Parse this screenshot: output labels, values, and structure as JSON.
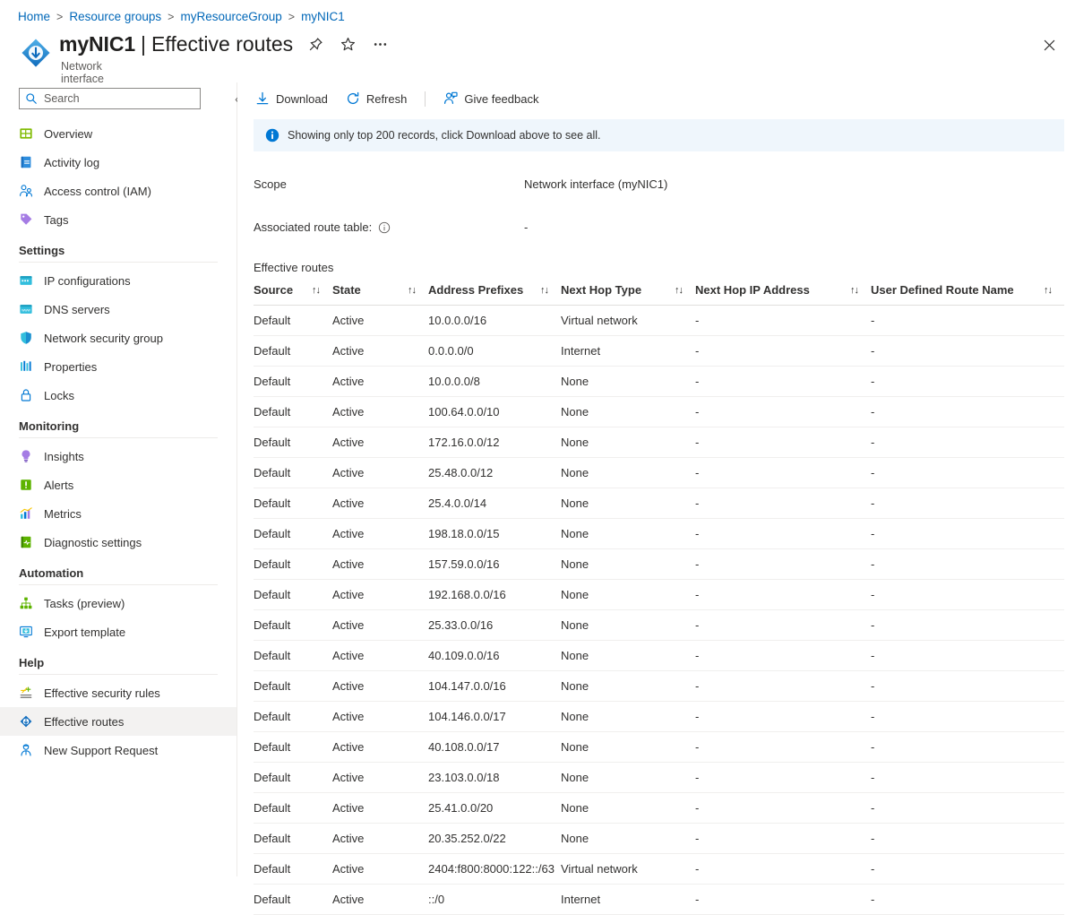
{
  "breadcrumb": [
    {
      "label": "Home"
    },
    {
      "label": "Resource groups"
    },
    {
      "label": "myResourceGroup"
    },
    {
      "label": "myNIC1"
    }
  ],
  "header": {
    "resource_name": "myNIC1",
    "separator": "|",
    "page_name": "Effective routes",
    "resource_type": "Network interface",
    "pin_icon": "pin-icon",
    "favorite_icon": "star-icon",
    "more_icon": "ellipsis-icon",
    "close_icon": "close-icon",
    "nic_icon": "network-interface-icon"
  },
  "sidebar": {
    "search": {
      "placeholder": "Search",
      "value": "",
      "icon": "search-icon"
    },
    "collapse_icon": "chevron-double-left-icon",
    "top_items": [
      {
        "label": "Overview",
        "icon": "overview-icon",
        "selected": false
      },
      {
        "label": "Activity log",
        "icon": "activity-log-icon",
        "selected": false
      },
      {
        "label": "Access control (IAM)",
        "icon": "access-control-icon",
        "selected": false
      },
      {
        "label": "Tags",
        "icon": "tag-icon",
        "selected": false
      }
    ],
    "groups": [
      {
        "title": "Settings",
        "items": [
          {
            "label": "IP configurations",
            "icon": "ip-config-icon",
            "selected": false
          },
          {
            "label": "DNS servers",
            "icon": "dns-server-icon",
            "selected": false
          },
          {
            "label": "Network security group",
            "icon": "shield-icon",
            "selected": false
          },
          {
            "label": "Properties",
            "icon": "properties-icon",
            "selected": false
          },
          {
            "label": "Locks",
            "icon": "lock-icon",
            "selected": false
          }
        ]
      },
      {
        "title": "Monitoring",
        "items": [
          {
            "label": "Insights",
            "icon": "insights-icon",
            "selected": false
          },
          {
            "label": "Alerts",
            "icon": "alerts-icon",
            "selected": false
          },
          {
            "label": "Metrics",
            "icon": "metrics-icon",
            "selected": false
          },
          {
            "label": "Diagnostic settings",
            "icon": "diagnostic-settings-icon",
            "selected": false
          }
        ]
      },
      {
        "title": "Automation",
        "items": [
          {
            "label": "Tasks (preview)",
            "icon": "tasks-icon",
            "selected": false
          },
          {
            "label": "Export template",
            "icon": "export-template-icon",
            "selected": false
          }
        ]
      },
      {
        "title": "Help",
        "items": [
          {
            "label": "Effective security rules",
            "icon": "effective-security-rules-icon",
            "selected": false
          },
          {
            "label": "Effective routes",
            "icon": "effective-routes-icon",
            "selected": true
          },
          {
            "label": "New Support Request",
            "icon": "support-request-icon",
            "selected": false
          }
        ]
      }
    ]
  },
  "toolbar": {
    "download_label": "Download",
    "download_icon": "download-icon",
    "refresh_label": "Refresh",
    "refresh_icon": "refresh-icon",
    "feedback_label": "Give feedback",
    "feedback_icon": "feedback-icon"
  },
  "notice": {
    "icon": "info-icon",
    "text": "Showing only top 200 records, click Download above to see all."
  },
  "details": {
    "scope_label": "Scope",
    "scope_value": "Network interface (myNIC1)",
    "route_table_label": "Associated route table:",
    "route_table_info_icon": "info-circle-icon",
    "route_table_value": "-"
  },
  "table": {
    "caption": "Effective routes",
    "sort_glyph": "↑↓",
    "columns": [
      {
        "key": "source",
        "label": "Source"
      },
      {
        "key": "state",
        "label": "State"
      },
      {
        "key": "prefix",
        "label": "Address Prefixes"
      },
      {
        "key": "next_hop_type",
        "label": "Next Hop Type"
      },
      {
        "key": "next_hop_ip",
        "label": "Next Hop IP Address"
      },
      {
        "key": "udr_name",
        "label": "User Defined Route Name"
      }
    ],
    "rows": [
      {
        "source": "Default",
        "state": "Active",
        "prefix": "10.0.0.0/16",
        "next_hop_type": "Virtual network",
        "next_hop_ip": "-",
        "udr_name": "-"
      },
      {
        "source": "Default",
        "state": "Active",
        "prefix": "0.0.0.0/0",
        "next_hop_type": "Internet",
        "next_hop_ip": "-",
        "udr_name": "-"
      },
      {
        "source": "Default",
        "state": "Active",
        "prefix": "10.0.0.0/8",
        "next_hop_type": "None",
        "next_hop_ip": "-",
        "udr_name": "-"
      },
      {
        "source": "Default",
        "state": "Active",
        "prefix": "100.64.0.0/10",
        "next_hop_type": "None",
        "next_hop_ip": "-",
        "udr_name": "-"
      },
      {
        "source": "Default",
        "state": "Active",
        "prefix": "172.16.0.0/12",
        "next_hop_type": "None",
        "next_hop_ip": "-",
        "udr_name": "-"
      },
      {
        "source": "Default",
        "state": "Active",
        "prefix": "25.48.0.0/12",
        "next_hop_type": "None",
        "next_hop_ip": "-",
        "udr_name": "-"
      },
      {
        "source": "Default",
        "state": "Active",
        "prefix": "25.4.0.0/14",
        "next_hop_type": "None",
        "next_hop_ip": "-",
        "udr_name": "-"
      },
      {
        "source": "Default",
        "state": "Active",
        "prefix": "198.18.0.0/15",
        "next_hop_type": "None",
        "next_hop_ip": "-",
        "udr_name": "-"
      },
      {
        "source": "Default",
        "state": "Active",
        "prefix": "157.59.0.0/16",
        "next_hop_type": "None",
        "next_hop_ip": "-",
        "udr_name": "-"
      },
      {
        "source": "Default",
        "state": "Active",
        "prefix": "192.168.0.0/16",
        "next_hop_type": "None",
        "next_hop_ip": "-",
        "udr_name": "-"
      },
      {
        "source": "Default",
        "state": "Active",
        "prefix": "25.33.0.0/16",
        "next_hop_type": "None",
        "next_hop_ip": "-",
        "udr_name": "-"
      },
      {
        "source": "Default",
        "state": "Active",
        "prefix": "40.109.0.0/16",
        "next_hop_type": "None",
        "next_hop_ip": "-",
        "udr_name": "-"
      },
      {
        "source": "Default",
        "state": "Active",
        "prefix": "104.147.0.0/16",
        "next_hop_type": "None",
        "next_hop_ip": "-",
        "udr_name": "-"
      },
      {
        "source": "Default",
        "state": "Active",
        "prefix": "104.146.0.0/17",
        "next_hop_type": "None",
        "next_hop_ip": "-",
        "udr_name": "-"
      },
      {
        "source": "Default",
        "state": "Active",
        "prefix": "40.108.0.0/17",
        "next_hop_type": "None",
        "next_hop_ip": "-",
        "udr_name": "-"
      },
      {
        "source": "Default",
        "state": "Active",
        "prefix": "23.103.0.0/18",
        "next_hop_type": "None",
        "next_hop_ip": "-",
        "udr_name": "-"
      },
      {
        "source": "Default",
        "state": "Active",
        "prefix": "25.41.0.0/20",
        "next_hop_type": "None",
        "next_hop_ip": "-",
        "udr_name": "-"
      },
      {
        "source": "Default",
        "state": "Active",
        "prefix": "20.35.252.0/22",
        "next_hop_type": "None",
        "next_hop_ip": "-",
        "udr_name": "-"
      },
      {
        "source": "Default",
        "state": "Active",
        "prefix": "2404:f800:8000:122::/63",
        "next_hop_type": "Virtual network",
        "next_hop_ip": "-",
        "udr_name": "-"
      },
      {
        "source": "Default",
        "state": "Active",
        "prefix": "::/0",
        "next_hop_type": "Internet",
        "next_hop_ip": "-",
        "udr_name": "-"
      }
    ]
  },
  "colors": {
    "link": "#0067b8",
    "accent": "#0078d4",
    "notice_bg": "#eff6fc",
    "selected_bg": "#f3f2f1",
    "text": "#323130",
    "muted": "#605e5c"
  }
}
